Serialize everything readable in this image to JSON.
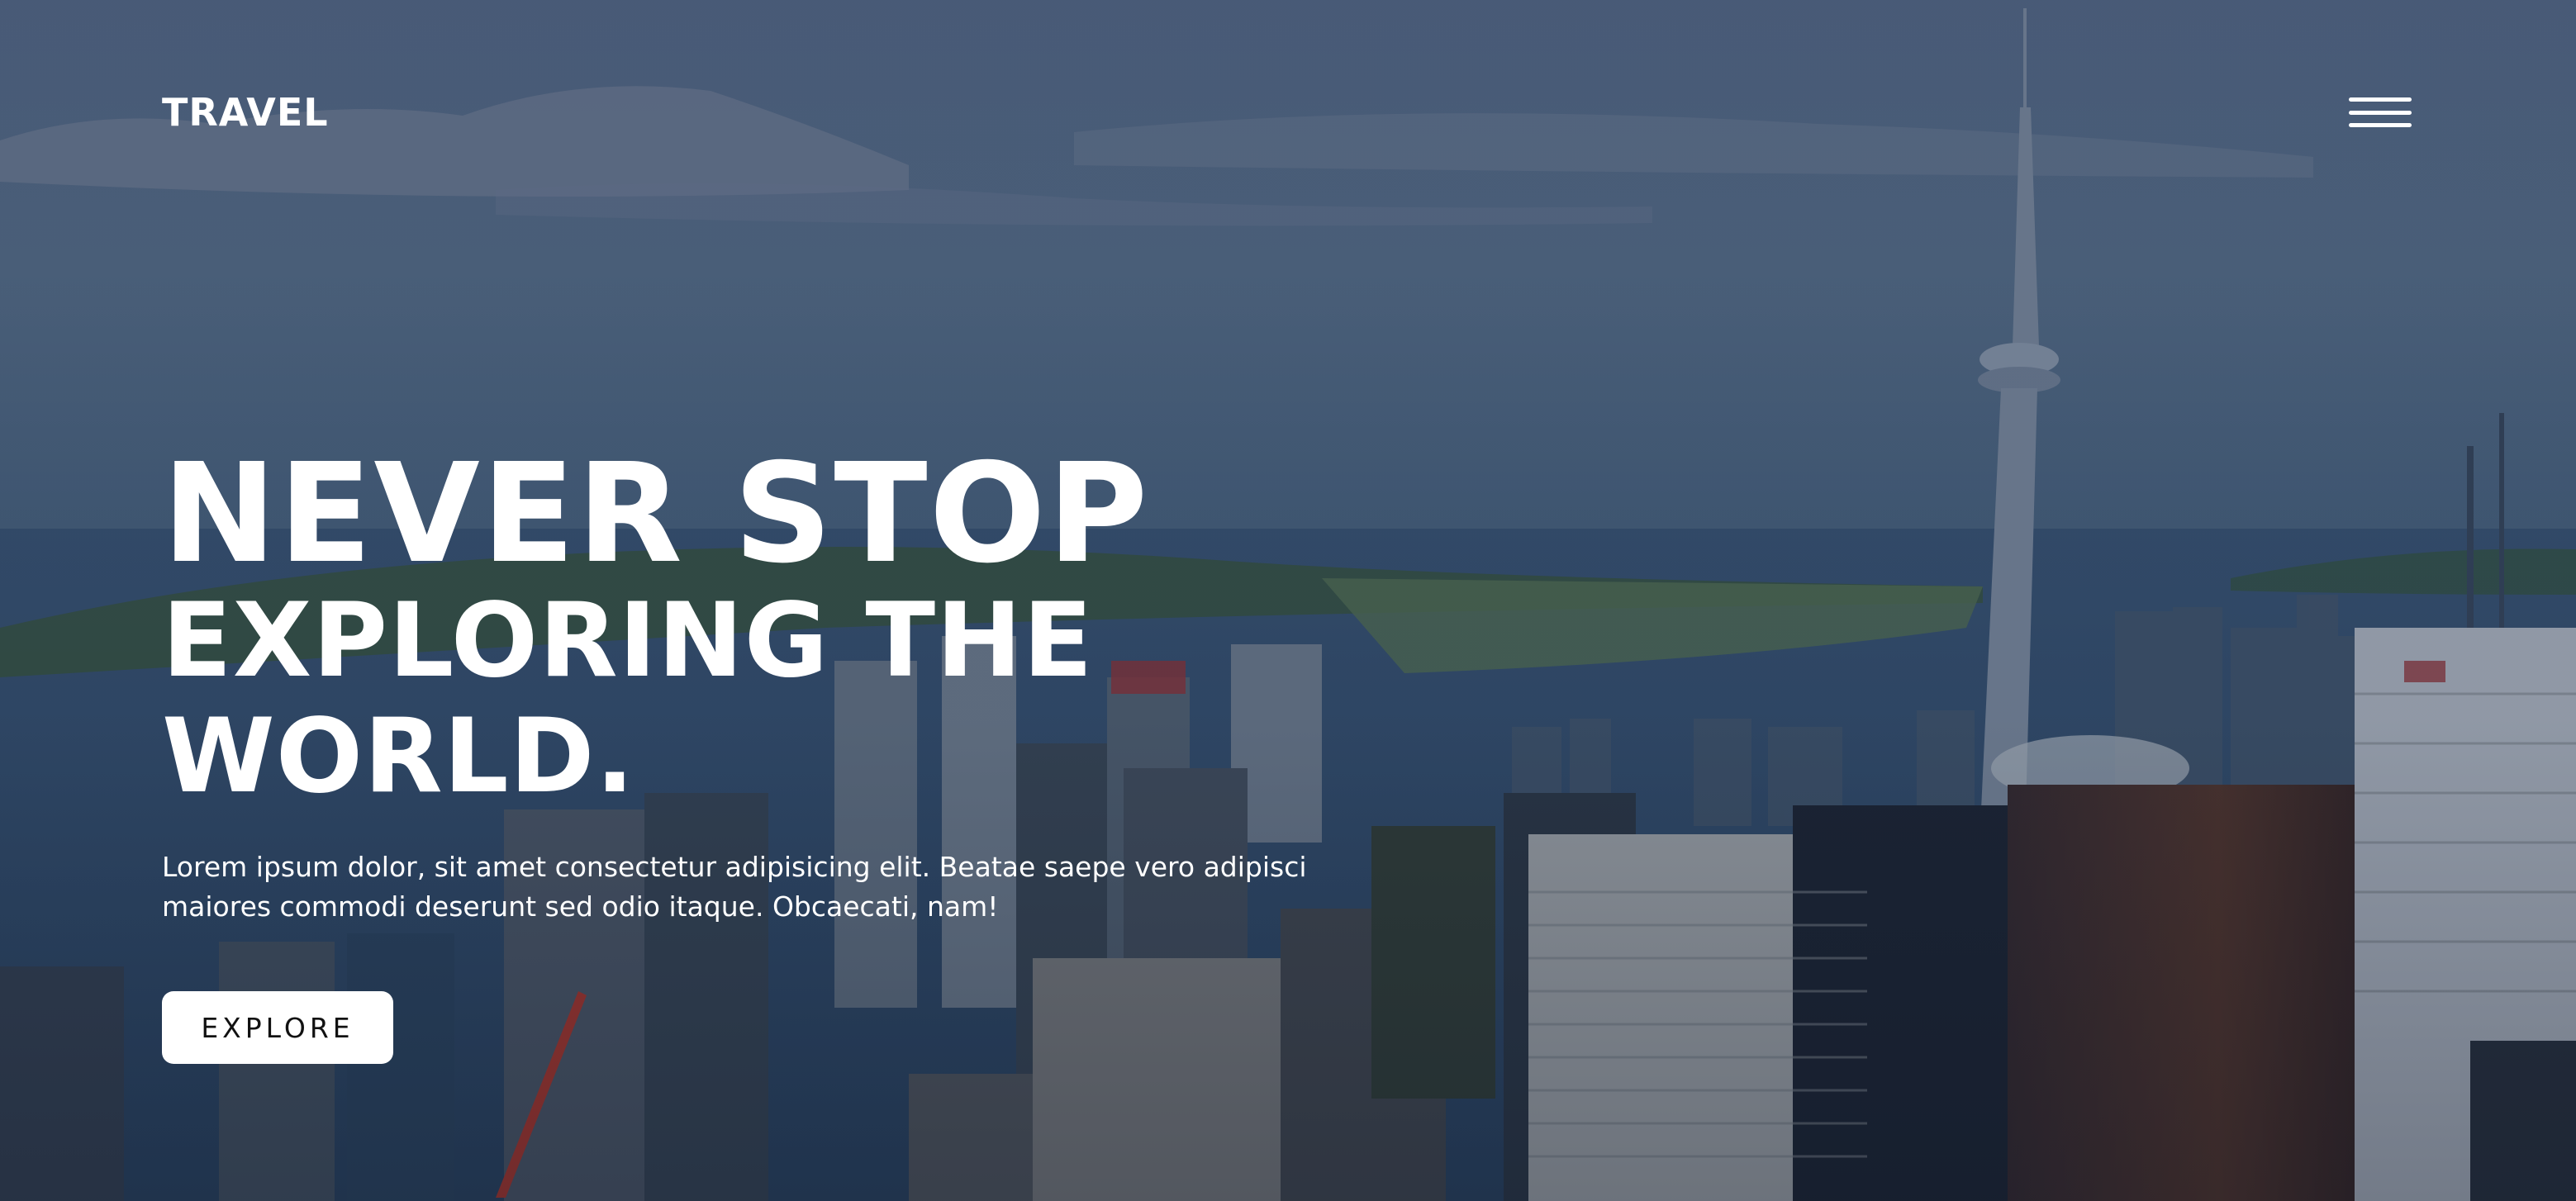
{
  "header": {
    "logo": "TRAVEL",
    "menu_icon": "hamburger-menu-icon"
  },
  "hero": {
    "title_line1": "NEVER STOP",
    "title_line2": "EXPLORING THE WORLD.",
    "description": "Lorem ipsum dolor, sit amet consectetur adipisicing elit. Beatae saepe vero adipisci maiores commodi deserunt sed odio itaque. Obcaecati, nam!",
    "cta_label": "EXPLORE"
  },
  "background": {
    "scene": "aerial-city-skyline-with-tower",
    "overlay_color": "#14223c"
  }
}
